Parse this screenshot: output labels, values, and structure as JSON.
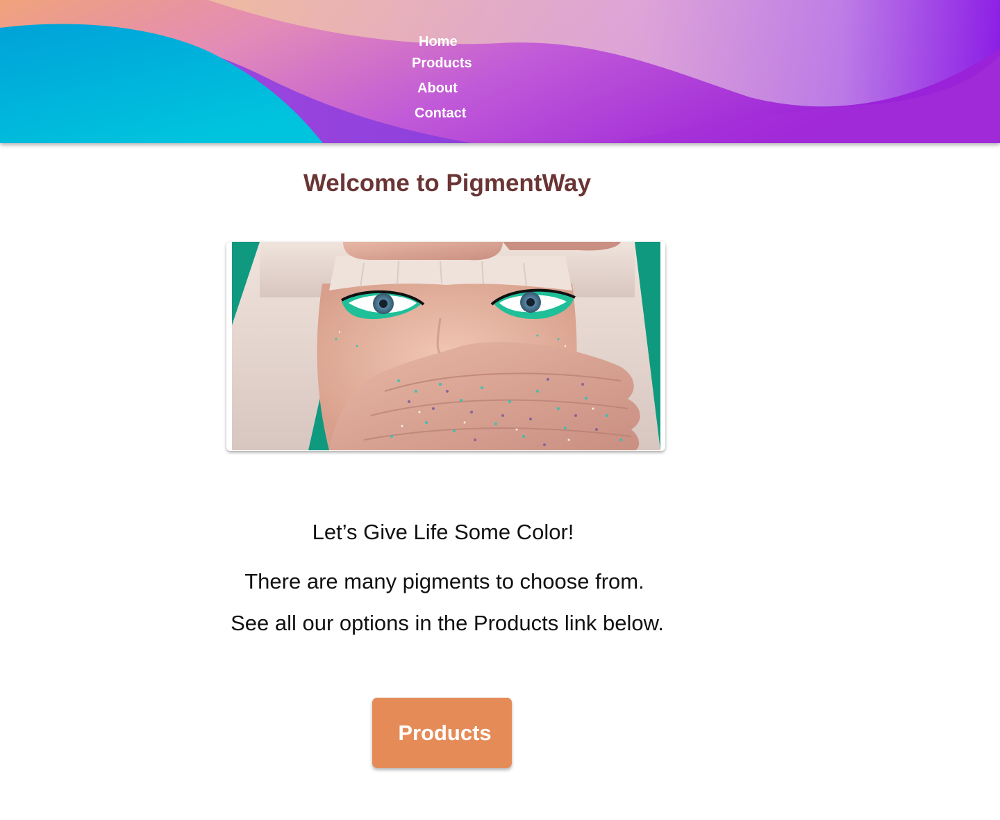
{
  "header": {
    "nav": [
      {
        "key": "home",
        "label": "Home"
      },
      {
        "key": "products",
        "label": "Products"
      },
      {
        "key": "about",
        "label": "About"
      },
      {
        "key": "contact",
        "label": "Contact"
      }
    ]
  },
  "main": {
    "title": "Welcome to PigmentWay",
    "hero_image_icon": "glitter-makeup-photo",
    "tagline": "Let’s Give Life Some Color!",
    "description_line1": "There are many pigments to choose from.",
    "description_line2": "See all our options in the Products link below.",
    "cta_label": "Products"
  },
  "colors": {
    "title": "#6b3535",
    "cta_background": "#e58b58",
    "header_gradient_start": "#f0b58a",
    "header_gradient_end": "#9a22d8",
    "header_wave_accent": "#00b8dc"
  }
}
